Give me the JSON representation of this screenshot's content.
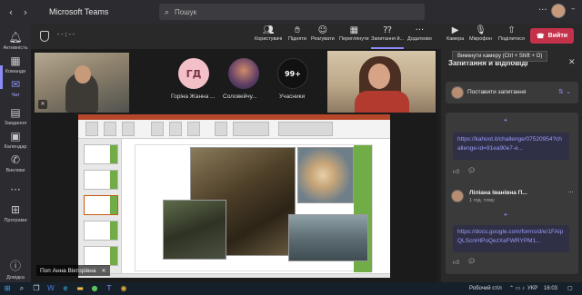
{
  "app": {
    "title": "Microsoft Teams"
  },
  "search": {
    "placeholder": "Пошук"
  },
  "rail": [
    {
      "label": "Активність",
      "icon": "bell-icon"
    },
    {
      "label": "Команди",
      "icon": "teams-icon"
    },
    {
      "label": "Чат",
      "icon": "chat-icon"
    },
    {
      "label": "Завдання",
      "icon": "assignments-icon"
    },
    {
      "label": "Календар",
      "icon": "calendar-icon"
    },
    {
      "label": "Виклики",
      "icon": "phone-icon"
    },
    {
      "label": "Програми",
      "icon": "apps-icon"
    },
    {
      "label": "Довідка",
      "icon": "help-icon"
    }
  ],
  "meeting": {
    "timer": "--:--",
    "buttons": [
      {
        "label": "Користувачі",
        "icon": "people-icon"
      },
      {
        "label": "Підняти",
        "icon": "raise-hand-icon"
      },
      {
        "label": "Реагувати",
        "icon": "react-icon"
      },
      {
        "label": "Переглянути",
        "icon": "view-icon"
      },
      {
        "label": "Запитання й...",
        "icon": "qa-icon"
      },
      {
        "label": "Додатково",
        "icon": "more-icon"
      },
      {
        "label": "Камера",
        "icon": "camera-icon"
      },
      {
        "label": "Мікрофон",
        "icon": "mic-off-icon"
      },
      {
        "label": "Поділитися",
        "icon": "share-icon"
      }
    ],
    "leave_label": "Вийти",
    "tooltip": "Вимкнути камеру (Ctrl + Shift + O)"
  },
  "participants": [
    {
      "initials": "ГД",
      "name": "Горіна Жанна ..."
    },
    {
      "initials": "",
      "name": "Соловейчу..."
    },
    {
      "initials": "99+",
      "name": "Учасники"
    }
  ],
  "presenter": {
    "name": "Поп Анна Вікторівна"
  },
  "qa": {
    "title": "Запитання й відповіді",
    "ask_label": "Поставити запитання",
    "questions": [
      {
        "author": "",
        "time": "",
        "text": "https://kahoot.it/challenge/07520954?challenge-id=91ea90e7-e..."
      },
      {
        "author": "Ліліана Іванівна П...",
        "time": "1 год. тому",
        "text": "https://docs.google.com/forms/d/e/1FAIpQLScnHlPoQezXeFWRYPM1..."
      }
    ]
  },
  "taskbar": {
    "desktop_label": "Робочий стіл",
    "lang": "УКР",
    "time": "16:03"
  }
}
